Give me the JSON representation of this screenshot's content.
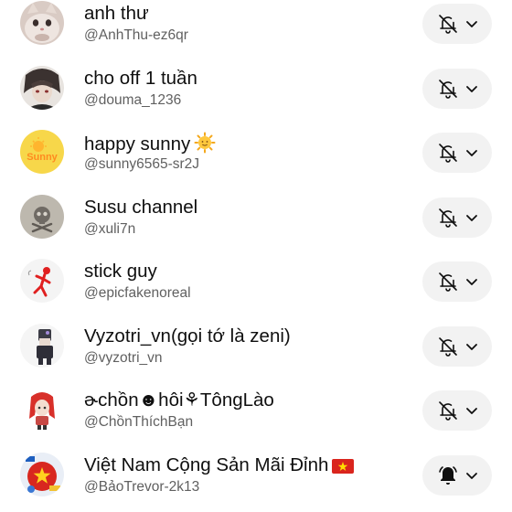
{
  "subscriptions": [
    {
      "name": "anh thư",
      "handle": "@AnhThu-ez6qr",
      "avatar": "cat-photo-avatar",
      "bell": "bell-off-icon"
    },
    {
      "name": "cho off 1 tuần",
      "handle": "@douma_1236",
      "avatar": "anime-character-avatar",
      "bell": "bell-off-icon"
    },
    {
      "name": "happy sunny",
      "handle": "@sunny6565-sr2J",
      "avatar": "sunny-logo-avatar",
      "bell": "bell-off-icon",
      "emoji": "sun-face-emoji"
    },
    {
      "name": "Susu channel",
      "handle": "@xuli7n",
      "avatar": "skull-avatar",
      "bell": "bell-off-icon"
    },
    {
      "name": "stick guy",
      "handle": "@epicfakenoreal",
      "avatar": "stick-figure-avatar",
      "bell": "bell-off-icon"
    },
    {
      "name": "Vyzotri_vn(gọi tớ là zeni)",
      "handle": "@vyzotri_vn",
      "avatar": "character-avatar",
      "bell": "bell-off-icon"
    },
    {
      "name": "ɚchồn☻hôi⚘TôngLào",
      "handle": "@ChồnThíchBạn",
      "avatar": "red-hair-character-avatar",
      "bell": "bell-off-icon"
    },
    {
      "name": "Việt Nam Cộng Sản Mãi Đỉnh",
      "handle": "@BảoTrevor-2k13",
      "avatar": "countryball-avatar",
      "bell": "bell-filled-icon",
      "emoji": "vietnam-flag-emoji"
    }
  ],
  "colors": {
    "button_bg": "#f2f2f2",
    "name_text": "#0f0f0f",
    "handle_text": "#606060"
  }
}
